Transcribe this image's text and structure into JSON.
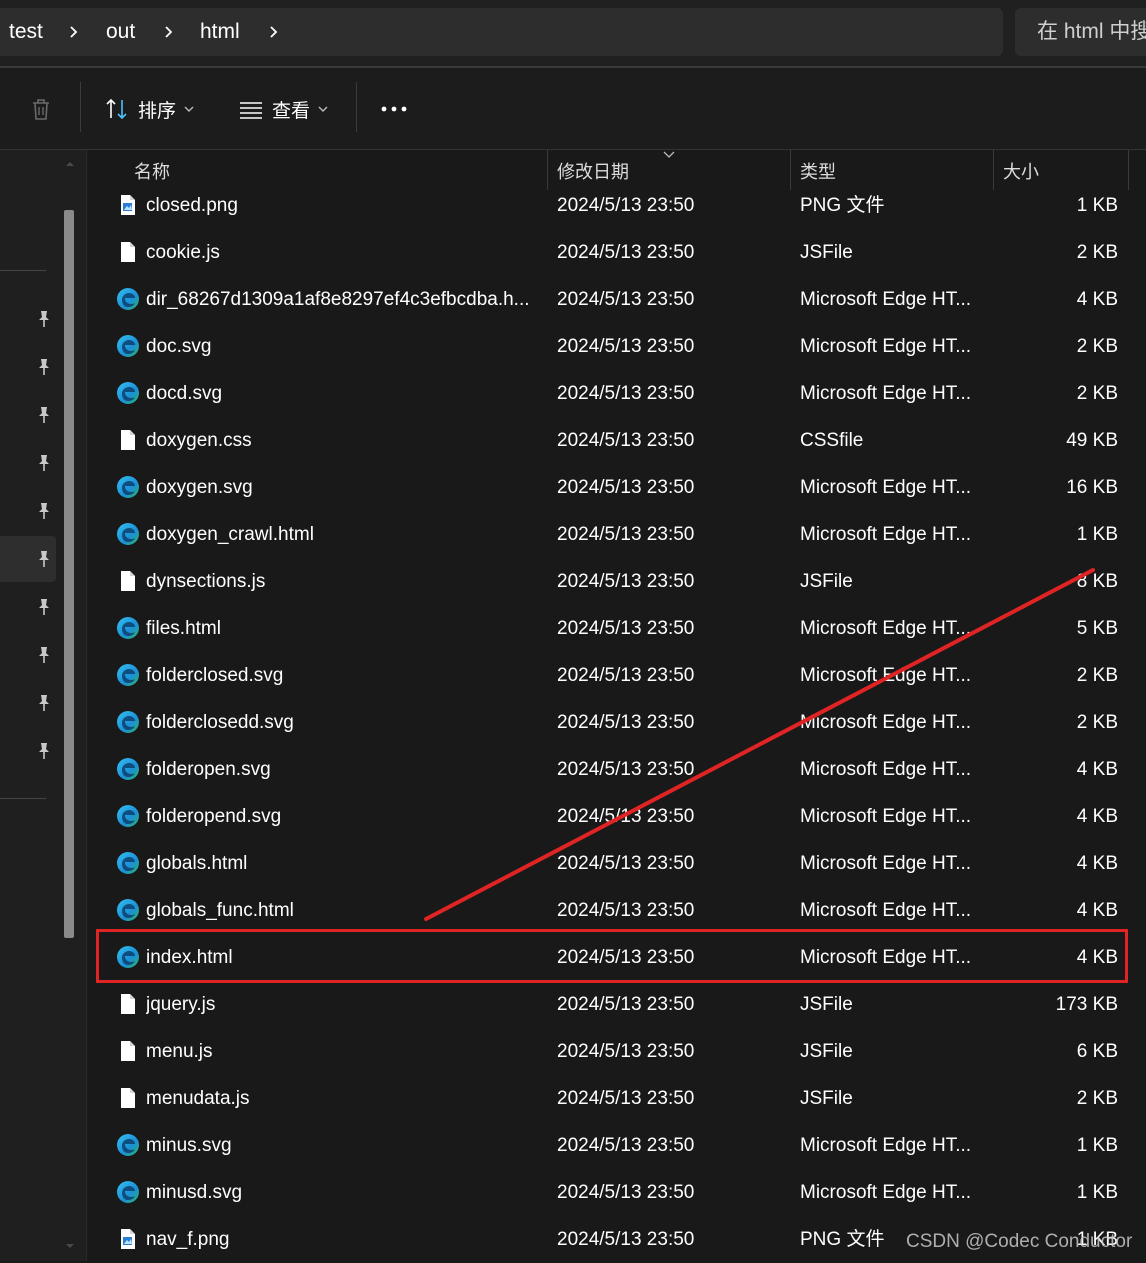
{
  "breadcrumb": [
    "test",
    "out",
    "html"
  ],
  "search": {
    "placeholder": "在 html 中搜"
  },
  "toolbar": {
    "delete_icon": "trash-icon",
    "sort_label": "排序",
    "view_label": "查看",
    "more_icon": "ellipsis-icon"
  },
  "columns": {
    "name": "名称",
    "date": "修改日期",
    "type": "类型",
    "size": "大小"
  },
  "sort_indicator": "chevron-down-icon",
  "files": [
    {
      "name": "closed.png",
      "date": "2024/5/13 23:50",
      "type": "PNG 文件",
      "size": "1 KB",
      "icon": "png-file-icon"
    },
    {
      "name": "cookie.js",
      "date": "2024/5/13 23:50",
      "type": "JSFile",
      "size": "2 KB",
      "icon": "blank-file-icon"
    },
    {
      "name": "dir_68267d1309a1af8e8297ef4c3efbcdba.h...",
      "date": "2024/5/13 23:50",
      "type": "Microsoft Edge HT...",
      "size": "4 KB",
      "icon": "edge-icon"
    },
    {
      "name": "doc.svg",
      "date": "2024/5/13 23:50",
      "type": "Microsoft Edge HT...",
      "size": "2 KB",
      "icon": "edge-icon"
    },
    {
      "name": "docd.svg",
      "date": "2024/5/13 23:50",
      "type": "Microsoft Edge HT...",
      "size": "2 KB",
      "icon": "edge-icon"
    },
    {
      "name": "doxygen.css",
      "date": "2024/5/13 23:50",
      "type": "CSSfile",
      "size": "49 KB",
      "icon": "blank-file-icon"
    },
    {
      "name": "doxygen.svg",
      "date": "2024/5/13 23:50",
      "type": "Microsoft Edge HT...",
      "size": "16 KB",
      "icon": "edge-icon"
    },
    {
      "name": "doxygen_crawl.html",
      "date": "2024/5/13 23:50",
      "type": "Microsoft Edge HT...",
      "size": "1 KB",
      "icon": "edge-icon"
    },
    {
      "name": "dynsections.js",
      "date": "2024/5/13 23:50",
      "type": "JSFile",
      "size": "8 KB",
      "icon": "blank-file-icon"
    },
    {
      "name": "files.html",
      "date": "2024/5/13 23:50",
      "type": "Microsoft Edge HT...",
      "size": "5 KB",
      "icon": "edge-icon"
    },
    {
      "name": "folderclosed.svg",
      "date": "2024/5/13 23:50",
      "type": "Microsoft Edge HT...",
      "size": "2 KB",
      "icon": "edge-icon"
    },
    {
      "name": "folderclosedd.svg",
      "date": "2024/5/13 23:50",
      "type": "Microsoft Edge HT...",
      "size": "2 KB",
      "icon": "edge-icon"
    },
    {
      "name": "folderopen.svg",
      "date": "2024/5/13 23:50",
      "type": "Microsoft Edge HT...",
      "size": "4 KB",
      "icon": "edge-icon"
    },
    {
      "name": "folderopend.svg",
      "date": "2024/5/13 23:50",
      "type": "Microsoft Edge HT...",
      "size": "4 KB",
      "icon": "edge-icon"
    },
    {
      "name": "globals.html",
      "date": "2024/5/13 23:50",
      "type": "Microsoft Edge HT...",
      "size": "4 KB",
      "icon": "edge-icon"
    },
    {
      "name": "globals_func.html",
      "date": "2024/5/13 23:50",
      "type": "Microsoft Edge HT...",
      "size": "4 KB",
      "icon": "edge-icon"
    },
    {
      "name": "index.html",
      "date": "2024/5/13 23:50",
      "type": "Microsoft Edge HT...",
      "size": "4 KB",
      "icon": "edge-icon",
      "highlighted": true
    },
    {
      "name": "jquery.js",
      "date": "2024/5/13 23:50",
      "type": "JSFile",
      "size": "173 KB",
      "icon": "blank-file-icon"
    },
    {
      "name": "menu.js",
      "date": "2024/5/13 23:50",
      "type": "JSFile",
      "size": "6 KB",
      "icon": "blank-file-icon"
    },
    {
      "name": "menudata.js",
      "date": "2024/5/13 23:50",
      "type": "JSFile",
      "size": "2 KB",
      "icon": "blank-file-icon"
    },
    {
      "name": "minus.svg",
      "date": "2024/5/13 23:50",
      "type": "Microsoft Edge HT...",
      "size": "1 KB",
      "icon": "edge-icon"
    },
    {
      "name": "minusd.svg",
      "date": "2024/5/13 23:50",
      "type": "Microsoft Edge HT...",
      "size": "1 KB",
      "icon": "edge-icon"
    },
    {
      "name": "nav_f.png",
      "date": "2024/5/13 23:50",
      "type": "PNG 文件",
      "size": "1 KB",
      "icon": "png-file-icon"
    }
  ],
  "nav_pins": 10,
  "annotation": {
    "color": "#e02424"
  },
  "watermark": "CSDN @Codec Conductor"
}
